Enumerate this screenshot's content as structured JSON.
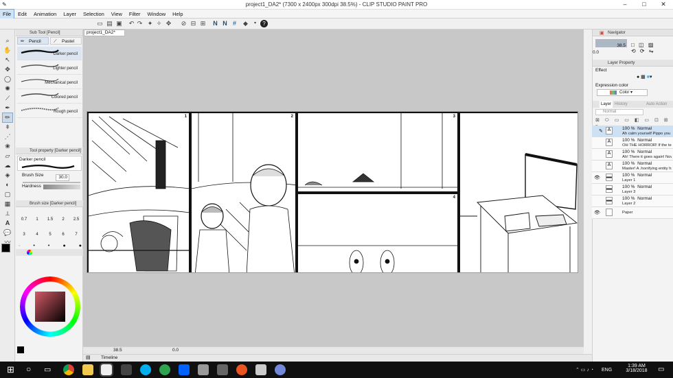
{
  "window": {
    "title": "project1_DA2* (7300 x 2400px 300dpi 38.5%) - CLIP STUDIO PAINT PRO"
  },
  "menu": [
    "File",
    "Edit",
    "Animation",
    "Layer",
    "Selection",
    "View",
    "Filter",
    "Window",
    "Help"
  ],
  "subtool": {
    "header": "Sub Tool [Pencil]",
    "tabs": [
      "Pencil",
      "Pastel"
    ],
    "brushes": [
      "Darker pencil",
      "Lighter pencil",
      "Mechanical pencil",
      "Colored pencil",
      "Rough pencil"
    ]
  },
  "tool_property": {
    "header": "Tool property [Darker pencil]",
    "preset": "Darker pencil",
    "brush_size_label": "Brush Size",
    "brush_size_value": "30.0",
    "hardness_label": "Hardness"
  },
  "brush_size_panel": {
    "header": "Brush size [Darker pencil]",
    "sizes": [
      "0.7",
      "1",
      "1.5",
      "2",
      "2.5",
      "3",
      "4",
      "5",
      "6",
      "7"
    ]
  },
  "document": {
    "tab": "project1_DA2*",
    "zoom": "38.5",
    "panel_numbers": [
      "1",
      "2",
      "3",
      "4"
    ]
  },
  "navigator": {
    "header": "Navigator",
    "zoom": "38.5",
    "rotation": "0.0"
  },
  "layer_property": {
    "header": "Layer Property",
    "effect_label": "Effect",
    "expression_label": "Expression color",
    "expression_value": "Color"
  },
  "layer_panel": {
    "tabs": [
      "Layer",
      "History",
      "Auto Action"
    ],
    "blend_mode": "Normal",
    "layers": [
      {
        "opacity": "100 %",
        "mode": "Normal",
        "name": "Ah calm yourself Pippo you sca",
        "type": "text",
        "visible": false,
        "selected": true
      },
      {
        "opacity": "100 %",
        "mode": "Normal",
        "name": "OH THE HORROR! If the teach",
        "type": "text",
        "visible": false,
        "selected": false
      },
      {
        "opacity": "100 %",
        "mode": "Normal",
        "name": "Ah! There it goes again! Now it",
        "type": "text",
        "visible": false,
        "selected": false
      },
      {
        "opacity": "100 %",
        "mode": "Normal",
        "name": "Master! A .horrifying entity has",
        "type": "text",
        "visible": false,
        "selected": false
      },
      {
        "opacity": "100 %",
        "mode": "Normal",
        "name": "Layer 1",
        "type": "raster",
        "visible": true,
        "selected": false
      },
      {
        "opacity": "100 %",
        "mode": "Normal",
        "name": "Layer 3",
        "type": "raster",
        "visible": false,
        "selected": false
      },
      {
        "opacity": "100 %",
        "mode": "Normal",
        "name": "Layer 2",
        "type": "raster",
        "visible": false,
        "selected": false
      },
      {
        "opacity": "",
        "mode": "",
        "name": "Paper",
        "type": "paper",
        "visible": true,
        "selected": false
      }
    ]
  },
  "timeline": {
    "label": "Timeline",
    "zoom": "38.5",
    "angle": "0.0"
  },
  "taskbar": {
    "lang": "ENG",
    "time": "1:39 AM",
    "date": "3/18/2018"
  },
  "colors": {
    "accent": "#cfe3f7",
    "taskbar": "#101010",
    "canvas_bg": "#c8c8c8",
    "nav_red": "#d9412f"
  },
  "icons": [
    "pencil-icon",
    "pastel-icon",
    "eye-icon",
    "windows-start-icon",
    "search-icon",
    "chrome-icon",
    "folder-icon",
    "color-wheel-icon"
  ]
}
